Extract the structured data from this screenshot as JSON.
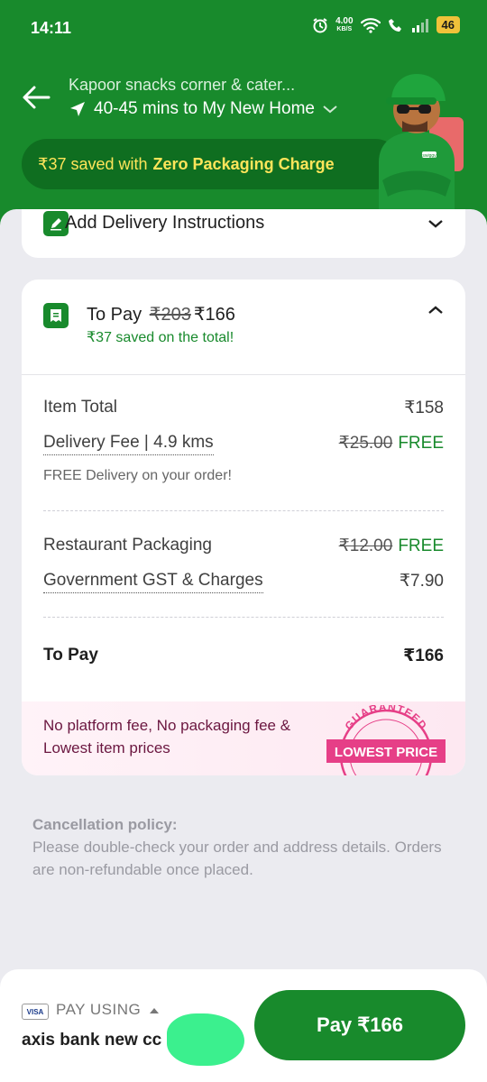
{
  "status_bar": {
    "time": "14:11",
    "net_speed_value": "4.00",
    "net_speed_unit": "KB/S",
    "battery": "46"
  },
  "header": {
    "restaurant": "Kapoor snacks corner & cater...",
    "eta": "40-45 mins to My New Home",
    "savings_amount": "₹37 saved with",
    "savings_highlight": "Zero Packaging Charge",
    "mascot_badge": "swiggy"
  },
  "instructions": {
    "label": "Add Delivery Instructions"
  },
  "bill": {
    "to_pay_label": "To Pay",
    "original_total": "₹203",
    "final_total": "₹166",
    "saved_text": "₹37 saved on the total!",
    "rows": {
      "item_total": {
        "label": "Item Total",
        "value": "₹158"
      },
      "delivery_fee": {
        "label": "Delivery Fee | 4.9 kms",
        "old": "₹25.00",
        "value": "FREE"
      },
      "delivery_note": "FREE Delivery on your order!",
      "packaging": {
        "label": "Restaurant Packaging",
        "old": "₹12.00",
        "value": "FREE"
      },
      "gst": {
        "label": "Government GST & Charges",
        "value": "₹7.90"
      },
      "to_pay": {
        "label": "To Pay",
        "value": "₹166"
      }
    },
    "promo_text": "No platform fee, No packaging fee & Lowest item prices",
    "badge_top": "GUARANTEED",
    "badge_main": "LOWEST PRICE"
  },
  "policy": {
    "title": "Cancellation policy:",
    "text": "Please double-check your order and address details. Orders are non-refundable once placed."
  },
  "footer": {
    "card_brand": "VISA",
    "pay_using": "PAY USING",
    "bank": "axis bank new cc",
    "pay_button": "Pay ₹166"
  },
  "colors": {
    "brand_green": "#188a2c",
    "highlight_yellow": "#ffe55a",
    "promo_pink": "#e63f87"
  }
}
